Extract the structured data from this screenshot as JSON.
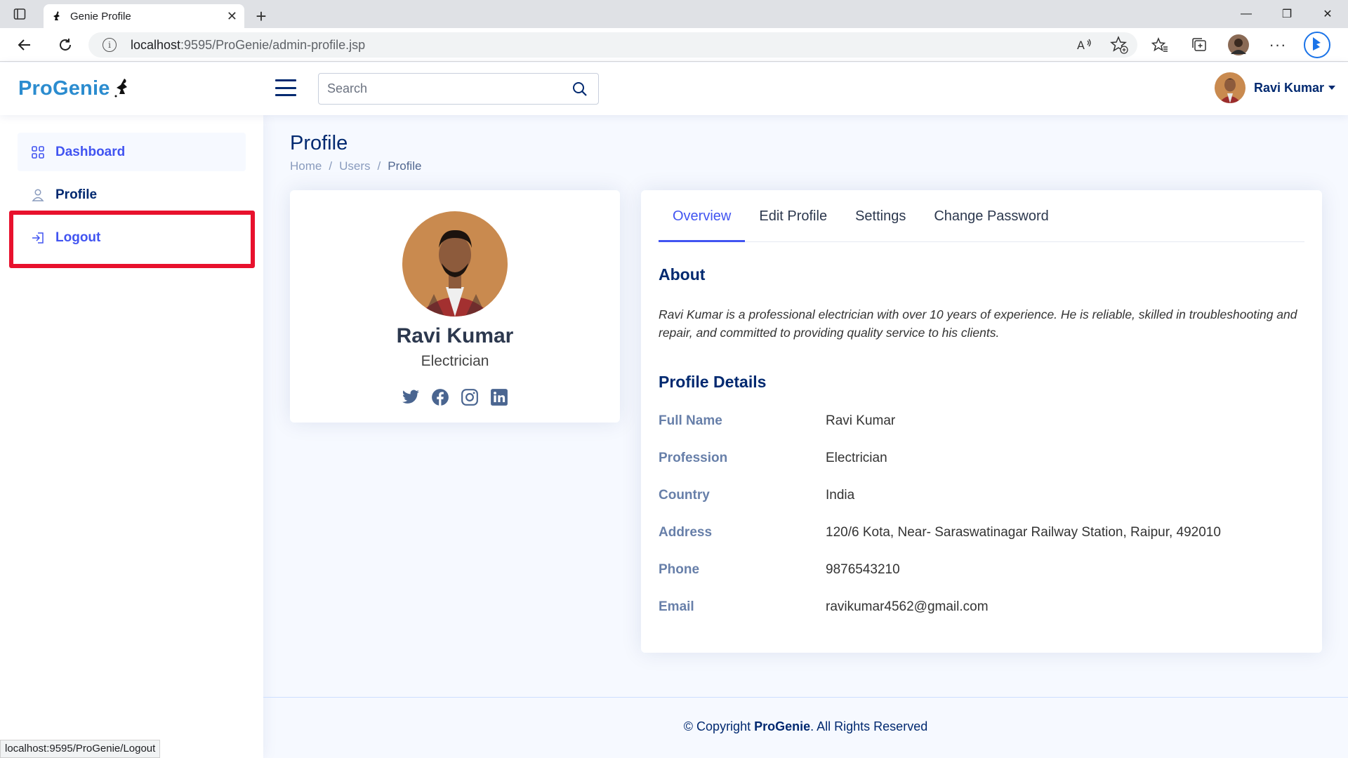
{
  "browser": {
    "tab_title": "Genie Profile",
    "url_host": "localhost",
    "url_path": ":9595/ProGenie/admin-profile.jsp",
    "status_url": "localhost:9595/ProGenie/Logout"
  },
  "header": {
    "brand": "ProGenie",
    "search_placeholder": "Search",
    "user_name": "Ravi Kumar"
  },
  "sidebar": {
    "items": [
      {
        "label": "Dashboard",
        "icon": "grid-icon"
      },
      {
        "label": "Profile",
        "icon": "person-icon"
      },
      {
        "label": "Logout",
        "icon": "logout-icon"
      }
    ]
  },
  "page": {
    "title": "Profile",
    "breadcrumb": [
      "Home",
      "Users",
      "Profile"
    ],
    "breadcrumb_sep": "/"
  },
  "profile_card": {
    "name": "Ravi Kumar",
    "profession": "Electrician",
    "socials": [
      "twitter-icon",
      "facebook-icon",
      "instagram-icon",
      "linkedin-icon"
    ]
  },
  "tabs": [
    "Overview",
    "Edit Profile",
    "Settings",
    "Change Password"
  ],
  "about": {
    "heading": "About",
    "text": "Ravi Kumar is a professional electrician with over 10 years of experience. He is reliable, skilled in troubleshooting and repair, and committed to providing quality service to his clients."
  },
  "details": {
    "heading": "Profile Details",
    "rows": [
      {
        "label": "Full Name",
        "value": "Ravi Kumar"
      },
      {
        "label": "Profession",
        "value": "Electrician"
      },
      {
        "label": "Country",
        "value": "India"
      },
      {
        "label": "Address",
        "value": "120/6 Kota, Near- Saraswatinagar Railway Station, Raipur, 492010"
      },
      {
        "label": "Phone",
        "value": "9876543210"
      },
      {
        "label": "Email",
        "value": "ravikumar4562@gmail.com"
      }
    ]
  },
  "footer": {
    "prefix": "© Copyright",
    "brand": "ProGenie",
    "suffix": ". All Rights Reserved"
  },
  "colors": {
    "accent": "#4154f1",
    "navy": "#012970",
    "brand": "#2b8ccf",
    "highlight": "#e8112d"
  }
}
